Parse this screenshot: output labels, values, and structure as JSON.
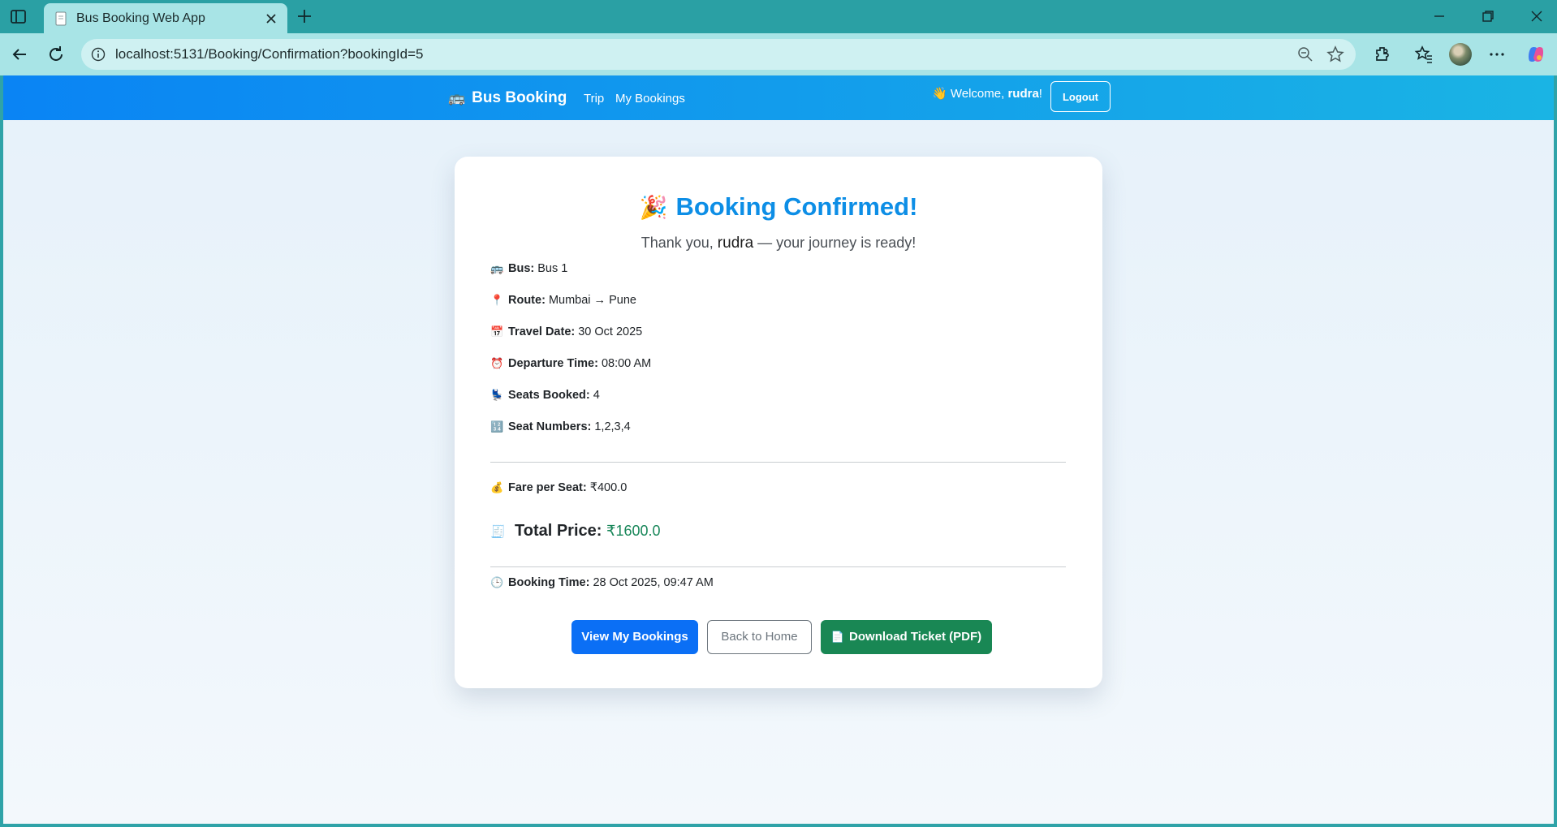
{
  "browser": {
    "tab_title": "Bus Booking Web App",
    "url": "localhost:5131/Booking/Confirmation?bookingId=5"
  },
  "navbar": {
    "brand_emoji": "🚌",
    "brand": "Bus Booking",
    "links": [
      "Trip",
      "My Bookings"
    ],
    "welcome_emoji": "👋",
    "welcome_prefix": "Welcome, ",
    "username": "rudra",
    "welcome_suffix": "!",
    "logout": "Logout"
  },
  "confirmation": {
    "title_emoji": "🎉",
    "title": "Booking Confirmed!",
    "subtitle_prefix": "Thank you, ",
    "subtitle_name": "rudra",
    "subtitle_suffix": " — your journey is ready!",
    "details": [
      {
        "icon": "🚌",
        "label": "Bus:",
        "value": " Bus 1"
      },
      {
        "icon": "📍",
        "label": "Route:",
        "value": " Mumbai → Pune"
      },
      {
        "icon": "📅",
        "label": "Travel Date:",
        "value": " 30 Oct 2025"
      },
      {
        "icon": "⏰",
        "label": "Departure Time:",
        "value": " 08:00 AM"
      },
      {
        "icon": "💺",
        "label": "Seats Booked:",
        "value": " 4"
      },
      {
        "icon": "🔢",
        "label": "Seat Numbers:",
        "value": " 1,2,3,4"
      }
    ],
    "fare": {
      "icon": "💰",
      "label": "Fare per Seat:",
      "value": " ₹400.0"
    },
    "total": {
      "icon": "🧾",
      "label": "Total Price:",
      "value": "₹1600.0"
    },
    "booking_time": {
      "icon": "🕒",
      "label": "Booking Time:",
      "value": " 28 Oct 2025, 09:47 AM"
    },
    "buttons": {
      "view_bookings": "View My Bookings",
      "back_home": "Back to Home",
      "download_icon": "📄",
      "download": "Download Ticket (PDF)"
    }
  },
  "colors": {
    "navbar_start": "#0a84f4",
    "navbar_end": "#1ab4e4",
    "title": "#0d8ee6",
    "total_price": "#19875a",
    "primary_button": "#0b6ff5",
    "success_button": "#198754"
  }
}
